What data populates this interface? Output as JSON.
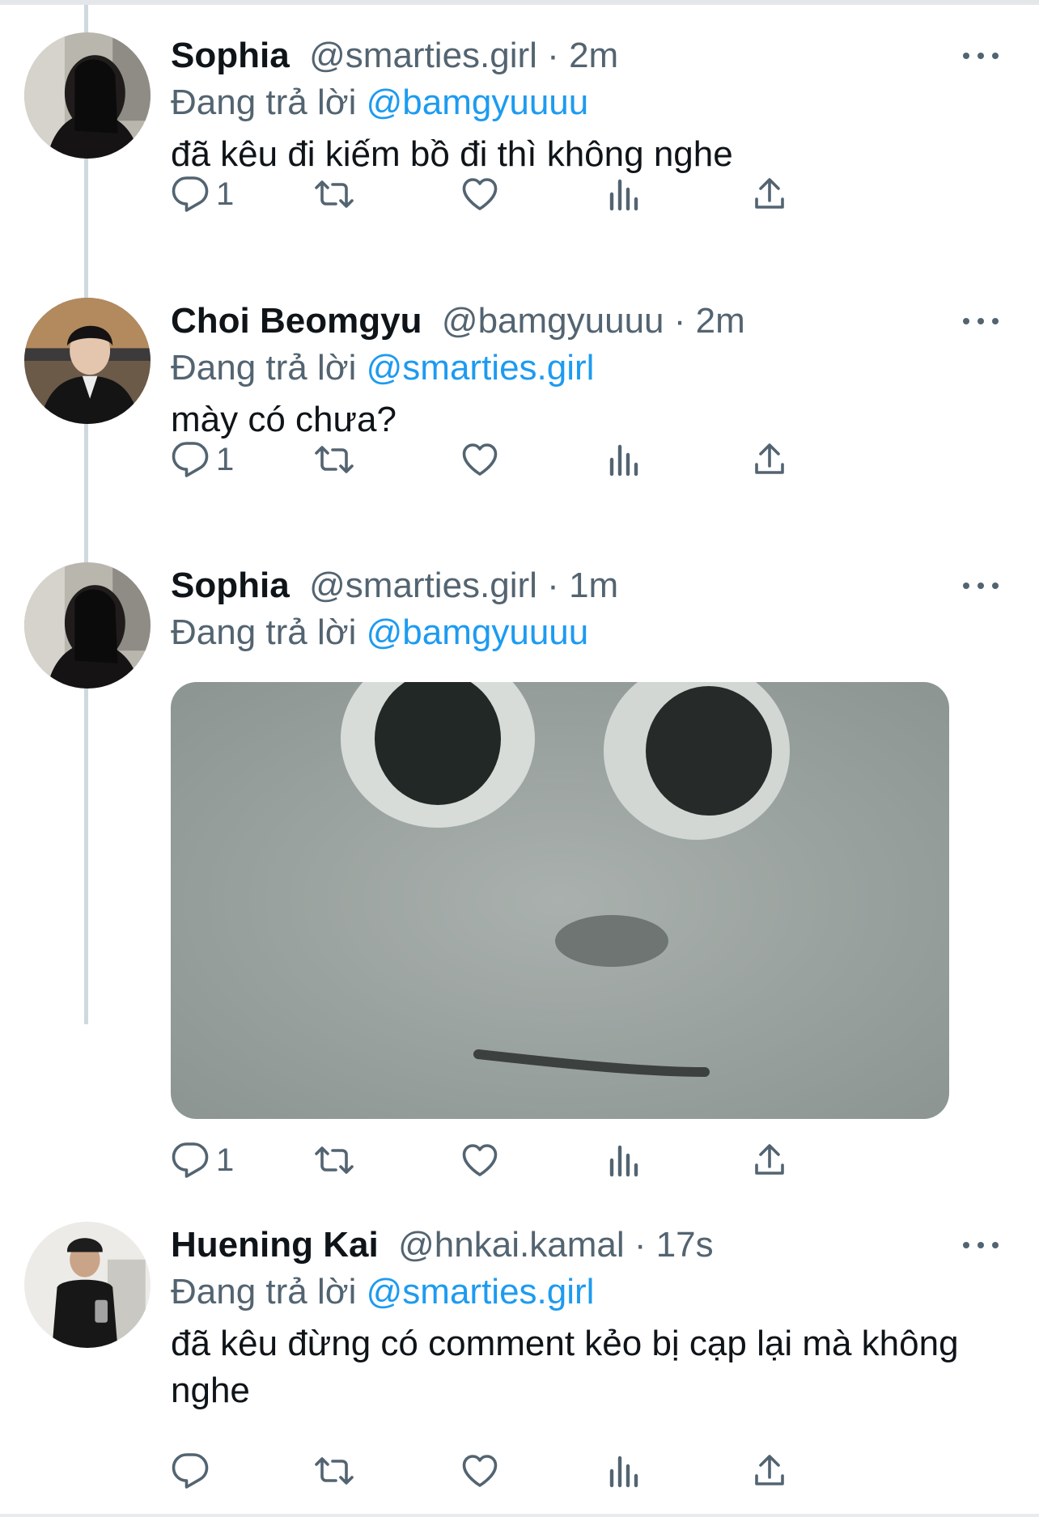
{
  "tweets": [
    {
      "name": "Sophia",
      "handle": "@smarties.girl",
      "sep": " · ",
      "time": "2m",
      "reply_prefix": "Đang trả lời",
      "reply_to": "@bamgyuuuu",
      "text": "đã kêu đi kiếm bồ đi thì không nghe",
      "reply_count": "1"
    },
    {
      "name": "Choi Beomgyu",
      "handle": "@bamgyuuuu",
      "sep": " · ",
      "time": "2m",
      "reply_prefix": "Đang trả lời",
      "reply_to": "@smarties.girl",
      "text": "mày có chưa?",
      "reply_count": "1"
    },
    {
      "name": "Sophia",
      "handle": "@smarties.girl",
      "sep": " · ",
      "time": "1m",
      "reply_prefix": "Đang trả lời",
      "reply_to": "@bamgyuuuu",
      "reply_count": "1"
    },
    {
      "name": "Huening Kai",
      "handle": "@hnkai.kamal",
      "sep": " · ",
      "time": "17s",
      "reply_prefix": "Đang trả lời",
      "reply_to": "@smarties.girl",
      "text": "đã kêu đừng có comment kẻo bị cạp lại mà không nghe",
      "reply_count": ""
    }
  ],
  "colors": {
    "accent": "#1d9bf0",
    "secondary": "#536471",
    "thread_line": "#cfd9de"
  },
  "icons": [
    "reply-icon",
    "retweet-icon",
    "like-icon",
    "views-icon",
    "share-icon",
    "more-icon"
  ]
}
